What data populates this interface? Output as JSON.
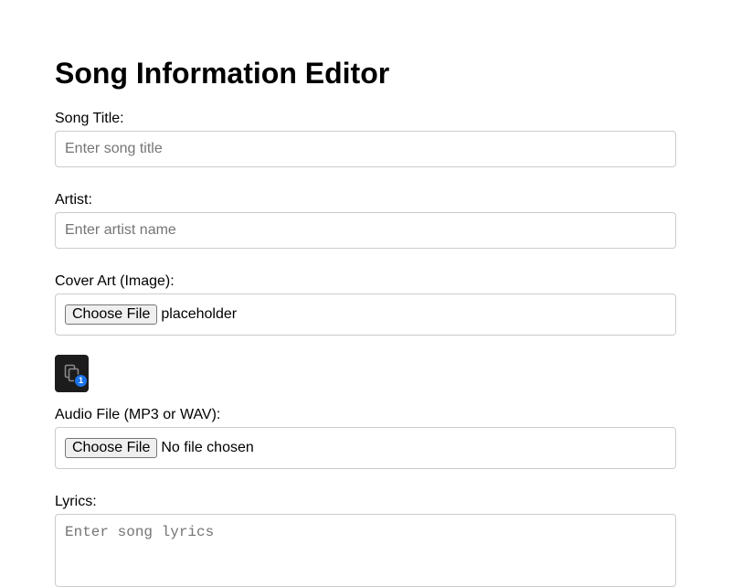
{
  "page": {
    "title": "Song Information Editor"
  },
  "form": {
    "song_title": {
      "label": "Song Title:",
      "placeholder": "Enter song title",
      "value": ""
    },
    "artist": {
      "label": "Artist:",
      "placeholder": "Enter artist name",
      "value": ""
    },
    "cover_art": {
      "label": "Cover Art (Image):",
      "button_label": "Choose File",
      "file_name": "placeholder",
      "preview": {
        "icon": "copy-files-icon",
        "badge_count": "1",
        "background_color": "#1c1c1c",
        "badge_color": "#1a73e8"
      }
    },
    "audio_file": {
      "label": "Audio File (MP3 or WAV):",
      "button_label": "Choose File",
      "file_name": "No file chosen"
    },
    "lyrics": {
      "label": "Lyrics:",
      "placeholder": "Enter song lyrics",
      "value": ""
    }
  }
}
